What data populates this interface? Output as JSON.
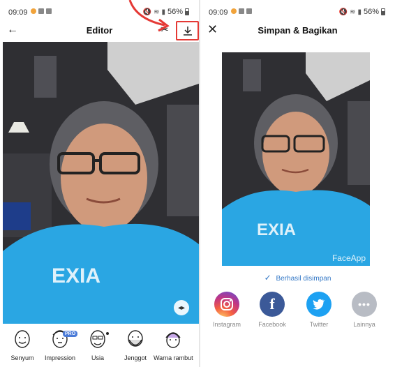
{
  "left": {
    "status": {
      "time": "09:09",
      "battery": "56%"
    },
    "header": {
      "title": "Editor"
    },
    "watermark": "",
    "filters": [
      {
        "label": "Senyum",
        "badge": ""
      },
      {
        "label": "Impression",
        "badge": "PRO"
      },
      {
        "label": "Usia",
        "badge": ""
      },
      {
        "label": "Jenggot",
        "badge": ""
      },
      {
        "label": "Warna rambut",
        "badge": ""
      }
    ]
  },
  "right": {
    "status": {
      "time": "09:09",
      "battery": "56%"
    },
    "header": {
      "title": "Simpan & Bagikan"
    },
    "watermark": "FaceApp",
    "saved_message": "Berhasil disimpan",
    "share": [
      {
        "label": "Instagram",
        "icon": "instagram-icon",
        "color": "#d6307d"
      },
      {
        "label": "Facebook",
        "icon": "facebook-icon",
        "color": "#3b5998"
      },
      {
        "label": "Twitter",
        "icon": "twitter-icon",
        "color": "#1da1f2"
      },
      {
        "label": "Lainnya",
        "icon": "more-icon",
        "color": "#b8bcc4"
      }
    ]
  },
  "colors": {
    "accent_blue": "#3478c6",
    "annotation_red": "#e53935",
    "pro_badge": "#4a7bd8"
  }
}
